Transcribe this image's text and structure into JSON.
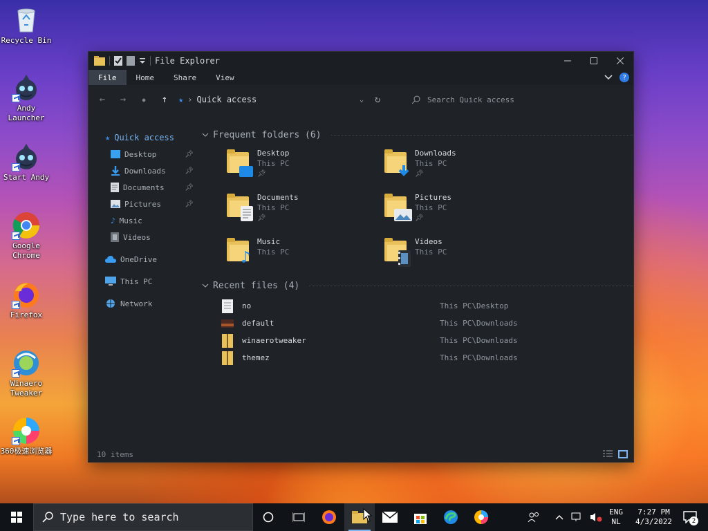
{
  "desktop": {
    "icons": [
      {
        "label": "Recycle Bin",
        "icon": "recycle-bin-icon"
      },
      {
        "label": "Andy Launcher",
        "icon": "andy-icon"
      },
      {
        "label": "Start Andy",
        "icon": "andy-icon"
      },
      {
        "label": "Google Chrome",
        "icon": "chrome-icon"
      },
      {
        "label": "Firefox",
        "icon": "firefox-icon"
      },
      {
        "label": "Winaero Tweaker",
        "icon": "winaero-icon"
      },
      {
        "label": "360极速浏览器",
        "icon": "360-browser-icon"
      }
    ]
  },
  "window": {
    "title": "File Explorer",
    "ribbon_tabs": [
      "File",
      "Home",
      "Share",
      "View"
    ],
    "active_tab": "File",
    "address": "Quick access",
    "search_placeholder": "Search Quick access",
    "status": "10 items"
  },
  "nav": {
    "quick_access": "Quick access",
    "pinned": [
      "Desktop",
      "Downloads",
      "Documents",
      "Pictures"
    ],
    "unpinned": [
      "Music",
      "Videos"
    ],
    "onedrive": "OneDrive",
    "this_pc": "This PC",
    "network": "Network"
  },
  "frequent": {
    "heading": "Frequent folders (6)",
    "folders": [
      {
        "name": "Desktop",
        "location": "This PC",
        "pinned": true
      },
      {
        "name": "Downloads",
        "location": "This PC",
        "pinned": true
      },
      {
        "name": "Documents",
        "location": "This PC",
        "pinned": true
      },
      {
        "name": "Pictures",
        "location": "This PC",
        "pinned": true
      },
      {
        "name": "Music",
        "location": "This PC",
        "pinned": false
      },
      {
        "name": "Videos",
        "location": "This PC",
        "pinned": false
      }
    ]
  },
  "recent": {
    "heading": "Recent files (4)",
    "files": [
      {
        "name": "no",
        "location": "This PC\\Desktop"
      },
      {
        "name": "default",
        "location": "This PC\\Downloads"
      },
      {
        "name": "winaerotweaker",
        "location": "This PC\\Downloads"
      },
      {
        "name": "themez",
        "location": "This PC\\Downloads"
      }
    ]
  },
  "taskbar": {
    "search_placeholder": "Type here to search",
    "lang_top": "ENG",
    "lang_bottom": "NL",
    "time": "7:27 PM",
    "date": "4/3/2022",
    "notifications": "2"
  },
  "colors": {
    "accent": "#2f7be6",
    "window_bg": "#1f2328",
    "taskbar_bg": "#101317"
  }
}
